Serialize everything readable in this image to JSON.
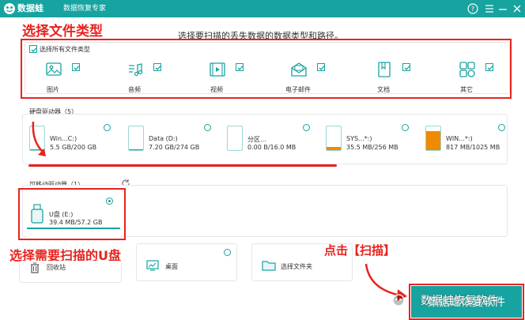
{
  "app": {
    "name": "数据蛙",
    "subtitle": "数据恢复专家"
  },
  "annotations": {
    "select_file_type": "选择文件类型",
    "select_udisk": "选择需要扫描的U盘",
    "click_scan": "点击【扫描】"
  },
  "instruction": "选择要扫描的丢失数据的数据类型和路径。",
  "file_types": {
    "select_all_label": "选择所有文件类型",
    "items": [
      {
        "label": "图片",
        "icon": "image-icon",
        "checked": true
      },
      {
        "label": "音频",
        "icon": "audio-icon",
        "checked": true
      },
      {
        "label": "视频",
        "icon": "video-icon",
        "checked": true
      },
      {
        "label": "电子邮件",
        "icon": "email-icon",
        "checked": true
      },
      {
        "label": "文档",
        "icon": "document-icon",
        "checked": true
      },
      {
        "label": "其它",
        "icon": "other-icon",
        "checked": true
      }
    ]
  },
  "hard_drives": {
    "title": "硬盘驱动器（5）",
    "items": [
      {
        "name": "Win...C:)",
        "size": "5.5 GB/200 GB",
        "used": 0.03,
        "fill_color": "#17a3a0"
      },
      {
        "name": "Data (D:)",
        "size": "7.20 GB/274 GB",
        "used": 0.03,
        "fill_color": "#17a3a0"
      },
      {
        "name": "分区...",
        "size": "0.00  B/16.0 MB",
        "used": 0.0,
        "fill_color": "#17a3a0"
      },
      {
        "name": "SYS...*:)",
        "size": "35.5 MB/256 MB",
        "used": 0.14,
        "fill_color": "#f08a00"
      },
      {
        "name": "WIN...*:)",
        "size": "817 MB/1025 MB",
        "used": 0.8,
        "fill_color": "#f08a00"
      }
    ]
  },
  "removable": {
    "title": "可移动驱动器（1）",
    "items": [
      {
        "name": "U盘 (E:)",
        "size": "39.4 MB/57.2 GB",
        "selected": true
      }
    ]
  },
  "locations": [
    {
      "label": "回收站",
      "icon": "recycle-bin-icon"
    },
    {
      "label": "桌面",
      "icon": "desktop-icon"
    },
    {
      "label": "选择文件夹",
      "icon": "folder-icon"
    }
  ],
  "scan_button": {
    "label": "数据蛙恢复软件"
  },
  "watermark": "数据蛙恢复软件",
  "colors": {
    "accent": "#17a3a0",
    "annotation": "#e8231e",
    "warning_fill": "#f08a00"
  }
}
